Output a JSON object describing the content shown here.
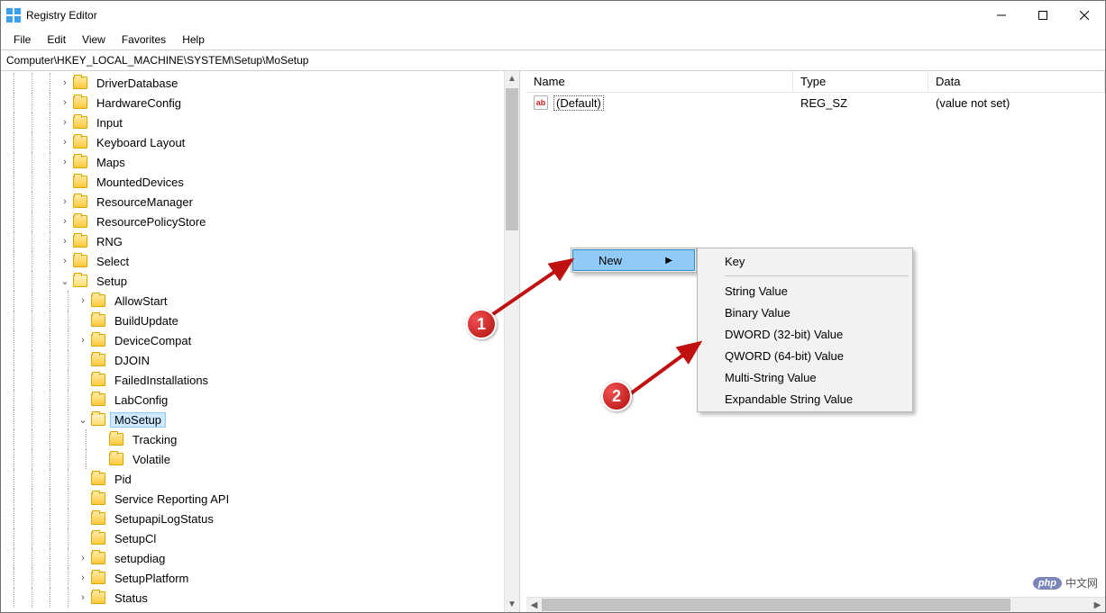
{
  "window": {
    "title": "Registry Editor"
  },
  "menu": {
    "file": "File",
    "edit": "Edit",
    "view": "View",
    "favorites": "Favorites",
    "help": "Help"
  },
  "address": "Computer\\HKEY_LOCAL_MACHINE\\SYSTEM\\Setup\\MoSetup",
  "tree": [
    {
      "indent": 3,
      "toggle": ">",
      "label": "DriverDatabase"
    },
    {
      "indent": 3,
      "toggle": ">",
      "label": "HardwareConfig"
    },
    {
      "indent": 3,
      "toggle": ">",
      "label": "Input"
    },
    {
      "indent": 3,
      "toggle": ">",
      "label": "Keyboard Layout"
    },
    {
      "indent": 3,
      "toggle": ">",
      "label": "Maps"
    },
    {
      "indent": 3,
      "toggle": "",
      "label": "MountedDevices"
    },
    {
      "indent": 3,
      "toggle": ">",
      "label": "ResourceManager"
    },
    {
      "indent": 3,
      "toggle": ">",
      "label": "ResourcePolicyStore"
    },
    {
      "indent": 3,
      "toggle": ">",
      "label": "RNG"
    },
    {
      "indent": 3,
      "toggle": ">",
      "label": "Select"
    },
    {
      "indent": 3,
      "toggle": "v",
      "label": "Setup",
      "open": true
    },
    {
      "indent": 4,
      "toggle": ">",
      "label": "AllowStart"
    },
    {
      "indent": 4,
      "toggle": "",
      "label": "BuildUpdate"
    },
    {
      "indent": 4,
      "toggle": ">",
      "label": "DeviceCompat"
    },
    {
      "indent": 4,
      "toggle": "",
      "label": "DJOIN"
    },
    {
      "indent": 4,
      "toggle": "",
      "label": "FailedInstallations"
    },
    {
      "indent": 4,
      "toggle": "",
      "label": "LabConfig"
    },
    {
      "indent": 4,
      "toggle": "v",
      "label": "MoSetup",
      "open": true,
      "selected": true
    },
    {
      "indent": 5,
      "toggle": "",
      "label": "Tracking"
    },
    {
      "indent": 5,
      "toggle": "",
      "label": "Volatile"
    },
    {
      "indent": 4,
      "toggle": "",
      "label": "Pid"
    },
    {
      "indent": 4,
      "toggle": "",
      "label": "Service Reporting API"
    },
    {
      "indent": 4,
      "toggle": "",
      "label": "SetupapiLogStatus"
    },
    {
      "indent": 4,
      "toggle": "",
      "label": "SetupCl"
    },
    {
      "indent": 4,
      "toggle": ">",
      "label": "setupdiag"
    },
    {
      "indent": 4,
      "toggle": ">",
      "label": "SetupPlatform"
    },
    {
      "indent": 4,
      "toggle": ">",
      "label": "Status"
    }
  ],
  "columns": {
    "name": "Name",
    "type": "Type",
    "data": "Data"
  },
  "values": [
    {
      "icon": "ab",
      "name": "(Default)",
      "type": "REG_SZ",
      "data": "(value not set)"
    }
  ],
  "ctx1": {
    "new": "New"
  },
  "ctx2": {
    "key": "Key",
    "string": "String Value",
    "binary": "Binary Value",
    "dword": "DWORD (32-bit) Value",
    "qword": "QWORD (64-bit) Value",
    "multi": "Multi-String Value",
    "expand": "Expandable String Value"
  },
  "badges": {
    "one": "1",
    "two": "2"
  },
  "watermark": {
    "logo": "php",
    "text": "中文网"
  }
}
